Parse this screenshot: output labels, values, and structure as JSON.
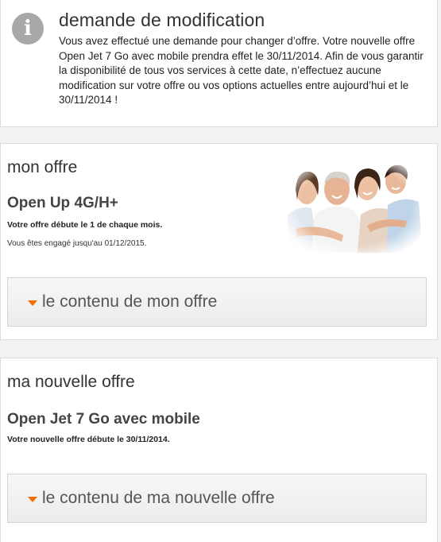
{
  "notice": {
    "icon": "info-icon",
    "icon_glyph": "i",
    "title": "demande de modification",
    "body": "Vous avez effectué une demande pour changer d’offre. Votre nouvelle offre Open Jet 7 Go avec mobile prendra effet le 30/11/2014. Afin de vous garantir la disponibilité de tous vos services à cette date, n’effectuez aucune modification sur votre offre ou vos options actuelles entre aujourd’hui et le 30/11/2014 !"
  },
  "current_offer": {
    "section_title": "mon offre",
    "name": "Open Up 4G/H+",
    "start_text": "Votre offre débute le 1 de chaque mois.",
    "commitment_text": "Vous êtes engagé jusqu'au 01/12/2015.",
    "expander_label": "le contenu de mon offre"
  },
  "new_offer": {
    "section_title": "ma nouvelle offre",
    "name": "Open Jet 7 Go avec mobile",
    "start_text": "Votre nouvelle offre débute le 30/11/2014.",
    "expander_label": "le contenu de ma nouvelle offre"
  },
  "colors": {
    "accent": "#f16e00",
    "icon_gray": "#a8a8a8"
  }
}
